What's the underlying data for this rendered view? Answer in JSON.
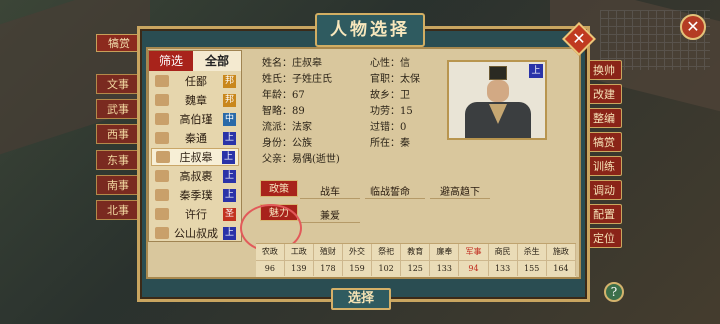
{
  "header": {
    "title": "人物选择",
    "top_left_tag": "犒赏"
  },
  "left_bg_tabs": [
    "文事",
    "武事",
    "西事",
    "东事",
    "南事",
    "北事"
  ],
  "right_menu": [
    "换帅",
    "改建",
    "整编",
    "犒赏",
    "训练",
    "调动",
    "配置",
    "定位"
  ],
  "filter": {
    "active_label": "筛选",
    "all_label": "全部",
    "items": [
      {
        "name": "任鄙",
        "badge": "邦",
        "badge_color": "#c9871c"
      },
      {
        "name": "魏章",
        "badge": "邦",
        "badge_color": "#c9871c"
      },
      {
        "name": "高伯瑾",
        "badge": "中",
        "badge_color": "#2a6aa8"
      },
      {
        "name": "秦通",
        "badge": "上",
        "badge_color": "#2a33a8"
      },
      {
        "name": "庄叔皋",
        "badge": "上",
        "badge_color": "#2a33a8"
      },
      {
        "name": "高叔裹",
        "badge": "上",
        "badge_color": "#2a33a8"
      },
      {
        "name": "秦季璞",
        "badge": "上",
        "badge_color": "#2a33a8"
      },
      {
        "name": "许行",
        "badge": "圣",
        "badge_color": "#c2321e"
      },
      {
        "name": "公山叔成",
        "badge": "上",
        "badge_color": "#2a33a8"
      }
    ],
    "selected_index": 4
  },
  "info": {
    "name_k": "姓名：",
    "name_v": "庄叔皋",
    "xing_k": "姓氏：",
    "xing_v": "子姓庄氏",
    "age_k": "年龄：",
    "age_v": "67",
    "zhi_k": "智略：",
    "zhi_v": "89",
    "school_k": "流派：",
    "school_v": "法家",
    "status_k": "身份：",
    "status_v": "公族",
    "father_k": "父亲：",
    "father_v": "易偶(逝世)",
    "heart_k": "心性：",
    "heart_v": "信",
    "office_k": "官职：",
    "office_v": "太保",
    "home_k": "故乡：",
    "home_v": "卫",
    "merit_k": "功劳：",
    "merit_v": "15",
    "fault_k": "过错：",
    "fault_v": "0",
    "loc_k": "所在：",
    "loc_v": "秦"
  },
  "portrait_badge": "上",
  "skills": {
    "tag1": "政策",
    "s1a": "战车",
    "s1b": "临战誓命",
    "s1c": "避高趋下",
    "tag2": "魅力",
    "s2a": "兼爱"
  },
  "stats": {
    "headers": [
      "农政",
      "工政",
      "殖财",
      "外交",
      "祭祀",
      "教育",
      "廉奉",
      "军事",
      "商民",
      "杀生",
      "施政"
    ],
    "values": [
      "96",
      "139",
      "178",
      "159",
      "102",
      "125",
      "133",
      "94",
      "133",
      "155",
      "164"
    ],
    "highlight_index": 7,
    "highlight_color": "#c02a1e"
  },
  "select_label": "选择",
  "help_label": "?"
}
